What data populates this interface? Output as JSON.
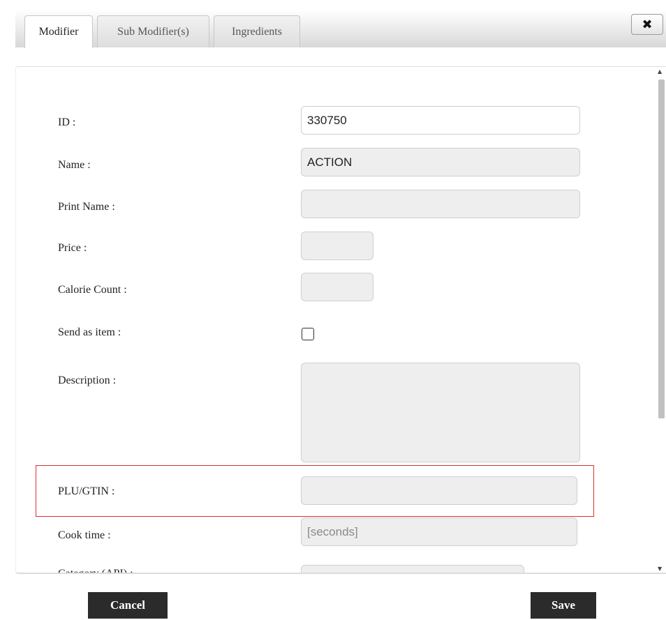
{
  "tabs": [
    {
      "label": "Modifier",
      "active": true
    },
    {
      "label": "Sub Modifier(s)",
      "active": false
    },
    {
      "label": "Ingredients",
      "active": false
    }
  ],
  "close_icon": "close-icon",
  "form": {
    "id_label": "ID :",
    "id_value": "330750",
    "name_label": "Name :",
    "name_value": "ACTION",
    "print_name_label": "Print Name :",
    "print_name_value": "",
    "price_label": "Price :",
    "price_value": "",
    "calorie_label": "Calorie Count :",
    "calorie_value": "",
    "send_as_item_label": "Send as item :",
    "send_as_item_checked": false,
    "description_label": "Description :",
    "description_value": "",
    "plu_label": "PLU/GTIN :",
    "plu_value": "",
    "cook_time_label": "Cook time :",
    "cook_time_placeholder": "[seconds]",
    "category_label": "Category (API) :"
  },
  "footer": {
    "cancel_label": "Cancel",
    "save_label": "Save"
  },
  "colors": {
    "highlight": "#d9322d",
    "button_bg": "#2b2b2b",
    "field_bg": "#eeeeee"
  }
}
